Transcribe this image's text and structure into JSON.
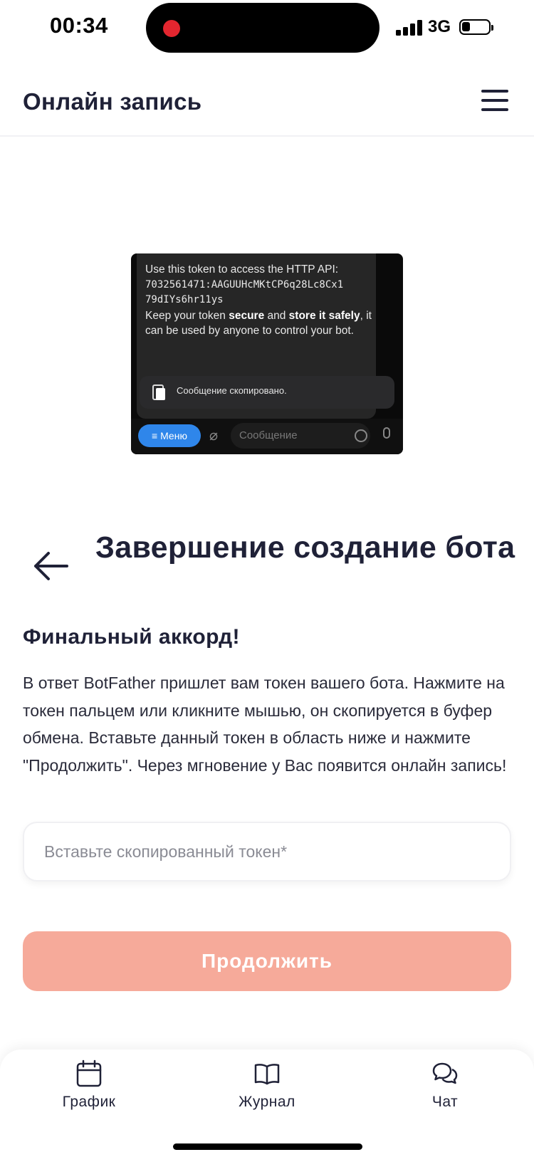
{
  "status_bar": {
    "time": "00:34",
    "network": "3G",
    "battery_level": 0.3
  },
  "header": {
    "title": "Онлайн запись"
  },
  "telegram_preview": {
    "line1": "Use this token to access the HTTP API:",
    "token_line1": "7032561471:AAGUUHcMKtCP6q28Lc8Cx1",
    "token_line2": "79dIYs6hr11ys",
    "keep_prefix": "Keep your token ",
    "keep_secure": "secure",
    "keep_and": " and ",
    "keep_store": "store it safely",
    "keep_rest": ", it can be used by anyone to control your bot.",
    "toast": "Сообщение скопировано.",
    "menu_button": "≡ Меню",
    "message_placeholder": "Сообщение"
  },
  "page": {
    "title": "Завершение создание бота",
    "subtitle": "Финальный аккорд!",
    "description": "В ответ BotFather пришлет вам токен вашего бота. Нажмите на токен пальцем или кликните мышью, он скопируется в буфер обмена. Вставьте данный токен в область ниже и нажмите \"Продолжить\". Через мгновение у Вас появится онлайн запись!",
    "token_placeholder": "Вставьте скопированный токен*",
    "continue_label": "Продолжить"
  },
  "bottom_nav": {
    "items": [
      {
        "label": "График",
        "icon": "calendar-icon"
      },
      {
        "label": "Журнал",
        "icon": "book-icon"
      },
      {
        "label": "Чат",
        "icon": "chat-icon"
      }
    ]
  },
  "colors": {
    "accent_button": "#f6aa9a",
    "text_dark": "#1f2137",
    "telegram_blue": "#2f86ea"
  }
}
